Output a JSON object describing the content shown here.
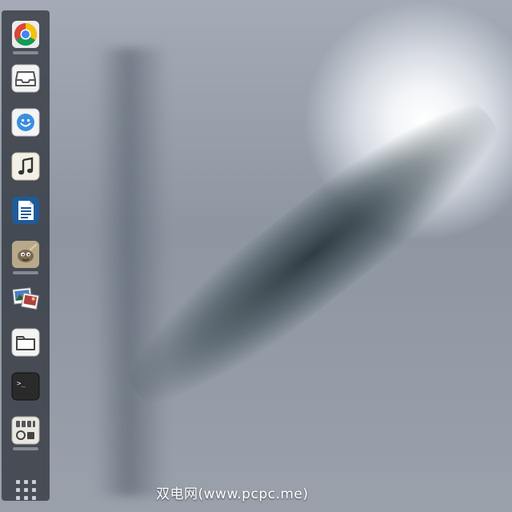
{
  "dock": {
    "items": [
      {
        "name": "chrome",
        "icon": "chrome-icon",
        "running": true
      },
      {
        "name": "mail",
        "icon": "inbox-tray-icon",
        "running": false
      },
      {
        "name": "messenger",
        "icon": "smiley-icon",
        "running": false
      },
      {
        "name": "music",
        "icon": "music-note-icon",
        "running": false
      },
      {
        "name": "documents",
        "icon": "document-icon",
        "running": false
      },
      {
        "name": "gimp",
        "icon": "gimp-icon",
        "running": true
      },
      {
        "name": "image-viewer",
        "icon": "photos-icon",
        "running": false
      },
      {
        "name": "files",
        "icon": "folder-icon",
        "running": false
      },
      {
        "name": "terminal",
        "icon": "terminal-icon",
        "running": false
      },
      {
        "name": "settings",
        "icon": "settings-mixer-icon",
        "running": true
      }
    ],
    "apps_grid_icon": "apps-grid-icon",
    "terminal_prompt": ">_"
  },
  "watermark": "双电网(www.pcpc.me)",
  "colors": {
    "dock_bg": "#282c34",
    "chrome_red": "#db4437",
    "chrome_yellow": "#f4c20d",
    "chrome_green": "#0f9d58",
    "chrome_blue": "#4285f4",
    "messenger_blue": "#3b8fe0",
    "document_blue": "#1f5b99",
    "terminal_bg": "#2a2a2a"
  }
}
